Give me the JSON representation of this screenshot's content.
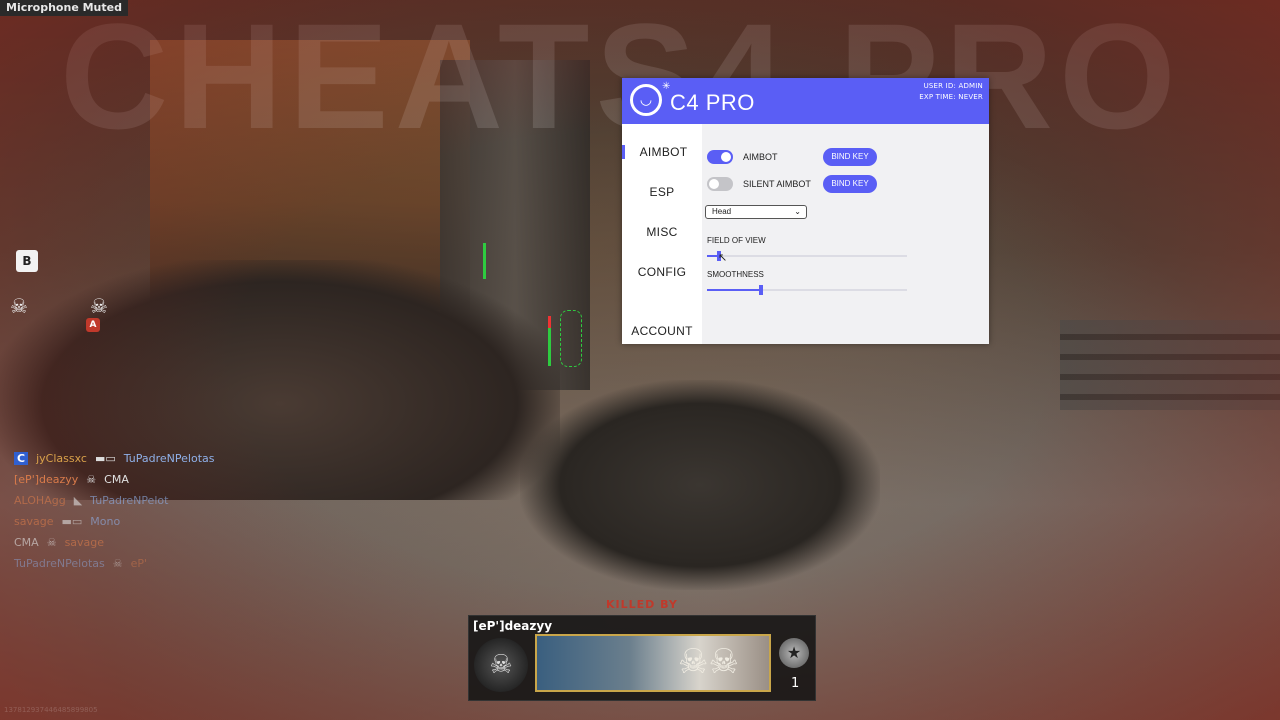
{
  "status_overlay": {
    "mic_status": "Microphone Muted"
  },
  "watermark": "CHEATS4.PRO",
  "hud": {
    "objective_b": "B",
    "objective_a": "A",
    "player_marker": "C"
  },
  "killfeed": [
    {
      "attacker": "jyClassxc",
      "victim": "TuPadreNPelotas",
      "attacker_color": "#d9a14a",
      "victim_color": "#8fb0e8"
    },
    {
      "attacker": "[eP']deazyy",
      "victim": "CMA",
      "attacker_color": "#d97b4a",
      "victim_color": "#e0e0e0"
    },
    {
      "attacker": "ALOHAgg",
      "victim": "TuPadreNPelot",
      "attacker_color": "#d97b4a",
      "victim_color": "#8fb0e8"
    },
    {
      "attacker": "savage",
      "victim": "Mono",
      "attacker_color": "#d97b4a",
      "victim_color": "#8fb0e8"
    },
    {
      "attacker": "CMA",
      "victim": "savage",
      "attacker_color": "#e0e0e0",
      "victim_color": "#d97b4a"
    },
    {
      "attacker": "TuPadreNPelotas",
      "victim": "eP'",
      "attacker_color": "#8fb0e8",
      "victim_color": "#d97b4a"
    }
  ],
  "panel": {
    "title": "C4 PRO",
    "user_id": "USER ID: ADMIN",
    "exp_time": "EXP TIME: NEVER",
    "accent": "#5a5ef5",
    "nav": [
      {
        "label": "AIMBOT",
        "active": true
      },
      {
        "label": "ESP",
        "active": false
      },
      {
        "label": "MISC",
        "active": false
      },
      {
        "label": "CONFIG",
        "active": false
      },
      {
        "label": "ACCOUNT",
        "active": false
      }
    ],
    "options": [
      {
        "label": "AIMBOT",
        "enabled": true,
        "bind_label": "BIND KEY"
      },
      {
        "label": "SILENT AIMBOT",
        "enabled": false,
        "bind_label": "BIND KEY"
      }
    ],
    "target_bone": "Head",
    "sliders": [
      {
        "label": "FIELD OF VIEW",
        "value_fraction": 0.06
      },
      {
        "label": "SMOOTHNESS",
        "value_fraction": 0.27
      }
    ]
  },
  "killcam": {
    "killed_by_label": "KILLED BY",
    "killer_name": "[eP']deazyy",
    "rank_level": "1"
  },
  "footer_id": "137812937446485899805"
}
